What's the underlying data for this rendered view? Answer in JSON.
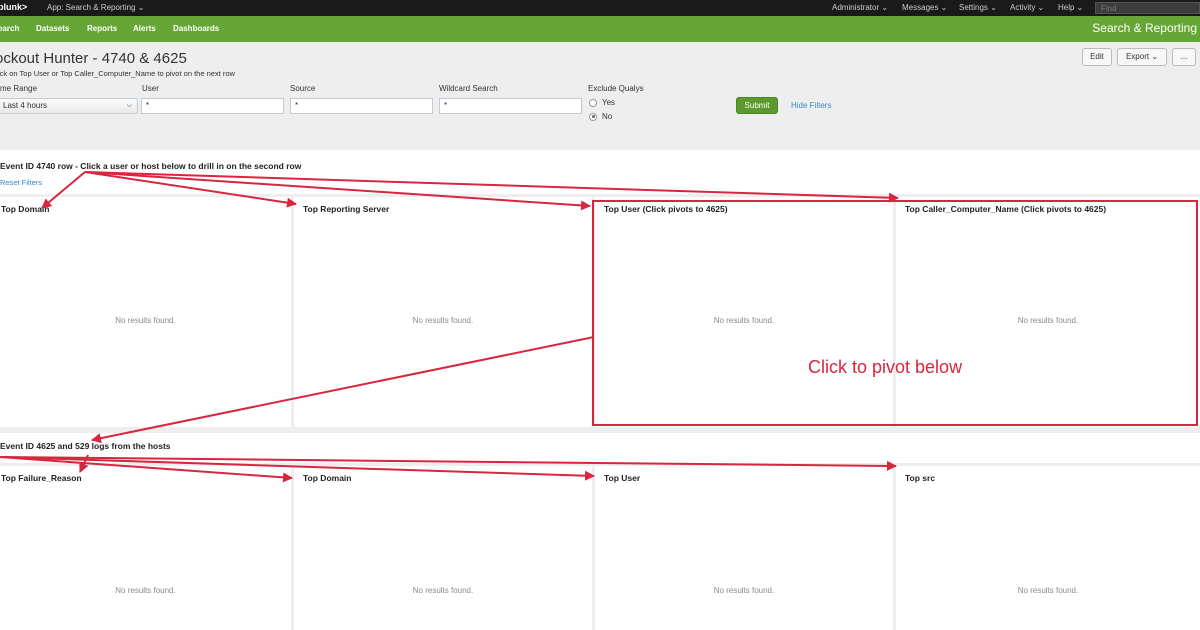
{
  "topbar": {
    "logo": "plunk>",
    "app": "App: Search & Reporting ⌄",
    "menu": [
      "Administrator ⌄",
      "Messages ⌄",
      "Settings ⌄",
      "Activity ⌄",
      "Help ⌄"
    ],
    "find_placeholder": "Find"
  },
  "nav": {
    "items": [
      "earch",
      "Datasets",
      "Reports",
      "Alerts",
      "Dashboards"
    ],
    "brand": "Search & Reporting"
  },
  "dashboard": {
    "title": "ockout Hunter - 4740 & 4625",
    "description": "ick on Top User or Top Caller_Computer_Name to pivot on the next row",
    "buttons": {
      "edit": "Edit",
      "export": "Export ⌄",
      "more": "..."
    }
  },
  "filters": {
    "time_range": {
      "label": "me Range",
      "value": "Last 4 hours"
    },
    "user": {
      "label": "User",
      "value": "*"
    },
    "source": {
      "label": "Source",
      "value": "*"
    },
    "wildcard": {
      "label": "Wildcard Search",
      "value": "*"
    },
    "exclude_qualys": {
      "label": "Exclude Qualys",
      "options": [
        "Yes",
        "No"
      ],
      "selected": "No"
    },
    "submit": "Submit",
    "hide_filters": "Hide Filters"
  },
  "row1": {
    "title": "Event ID 4740 row - Click a user or host below to drill in on the second row",
    "reset": "Reset Filters",
    "panels": [
      {
        "title": "Top Domain",
        "message": "No results found."
      },
      {
        "title": "Top Reporting Server",
        "message": "No results found."
      },
      {
        "title": "Top User (Click pivots to 4625)",
        "message": "No results found."
      },
      {
        "title": "Top Caller_Computer_Name (Click pivots to 4625)",
        "message": "No results found."
      }
    ]
  },
  "row2": {
    "title": "Event ID 4625 and 529 logs from the hosts",
    "panels": [
      {
        "title": "Top Failure_Reason",
        "message": "No results found."
      },
      {
        "title": "Top Domain",
        "message": "No results found."
      },
      {
        "title": "Top User",
        "message": "No results found."
      },
      {
        "title": "Top src",
        "message": "No results found."
      }
    ]
  },
  "annotation": {
    "text": "Click to pivot below",
    "color": "#d7263d"
  },
  "colors": {
    "nav_green": "#65a637",
    "topbar": "#1a1a1a",
    "link": "#3a87c6"
  }
}
